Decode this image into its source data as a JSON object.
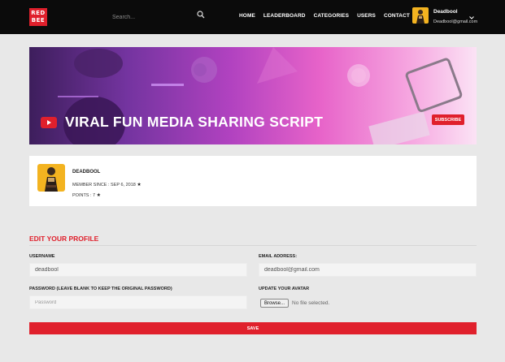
{
  "brand": {
    "logo_line1": "RED",
    "logo_line2": "BEE",
    "accent": "#e0202c"
  },
  "header": {
    "search_placeholder": "Search...",
    "nav": [
      "HOME",
      "LEADERBOARD",
      "CATEGORIES",
      "USERS",
      "CONTACT"
    ],
    "user": {
      "name": "Deadbool",
      "email": "Deadbool@gmail.com"
    }
  },
  "banner": {
    "title": "VIRAL FUN MEDIA SHARING SCRIPT",
    "subscribe_label": "SUBSCRIBE",
    "icon": "youtube-icon"
  },
  "profile": {
    "name": "DEADBOOL",
    "member_since": "MEMBER SINCE : SEP 6, 2018",
    "points": "POINTS : 7"
  },
  "edit": {
    "title": "EDIT YOUR PROFILE",
    "username_label": "USERNAME",
    "username_value": "deadbool",
    "email_label": "EMAIL ADDRESS:",
    "email_value": "deadbool@gmail.com",
    "password_label": "PASSWORD (LEAVE BLANK TO KEEP THE ORIGINAL PASSWORD)",
    "password_placeholder": "Password",
    "avatar_label": "UPDATE YOUR AVATAR",
    "browse_label": "Browse...",
    "no_file": "No file selected.",
    "save_label": "SAVE"
  }
}
